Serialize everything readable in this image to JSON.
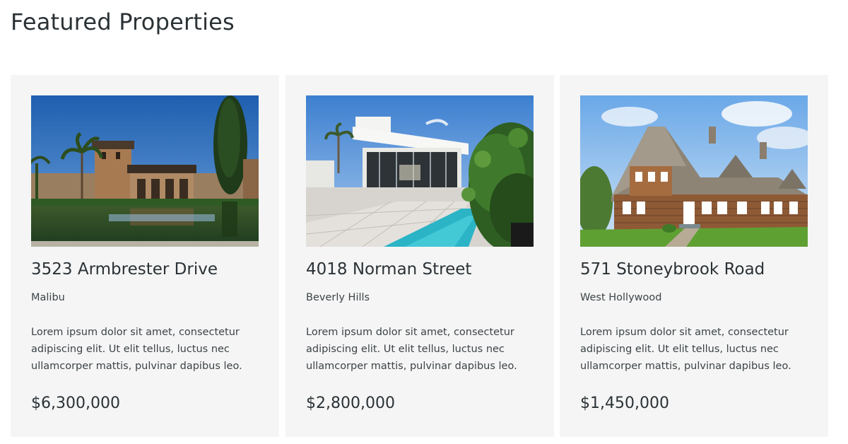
{
  "section": {
    "title": "Featured Properties"
  },
  "properties": [
    {
      "address": "3523 Armbrester Drive",
      "city": "Malibu",
      "description": "Lorem ipsum dolor sit amet, consectetur adipiscing elit. Ut elit tellus, luctus nec ullamcorper mattis, pulvinar dapibus leo.",
      "price": "$6,300,000"
    },
    {
      "address": "4018 Norman Street",
      "city": "Beverly Hills",
      "description": "Lorem ipsum dolor sit amet, consectetur adipiscing elit. Ut elit tellus, luctus nec ullamcorper mattis, pulvinar dapibus leo.",
      "price": "$2,800,000"
    },
    {
      "address": "571 Stoneybrook Road",
      "city": "West Hollywood",
      "description": "Lorem ipsum dolor sit amet, consectetur adipiscing elit. Ut elit tellus, luctus nec ullamcorper mattis, pulvinar dapibus leo.",
      "price": "$1,450,000"
    }
  ]
}
